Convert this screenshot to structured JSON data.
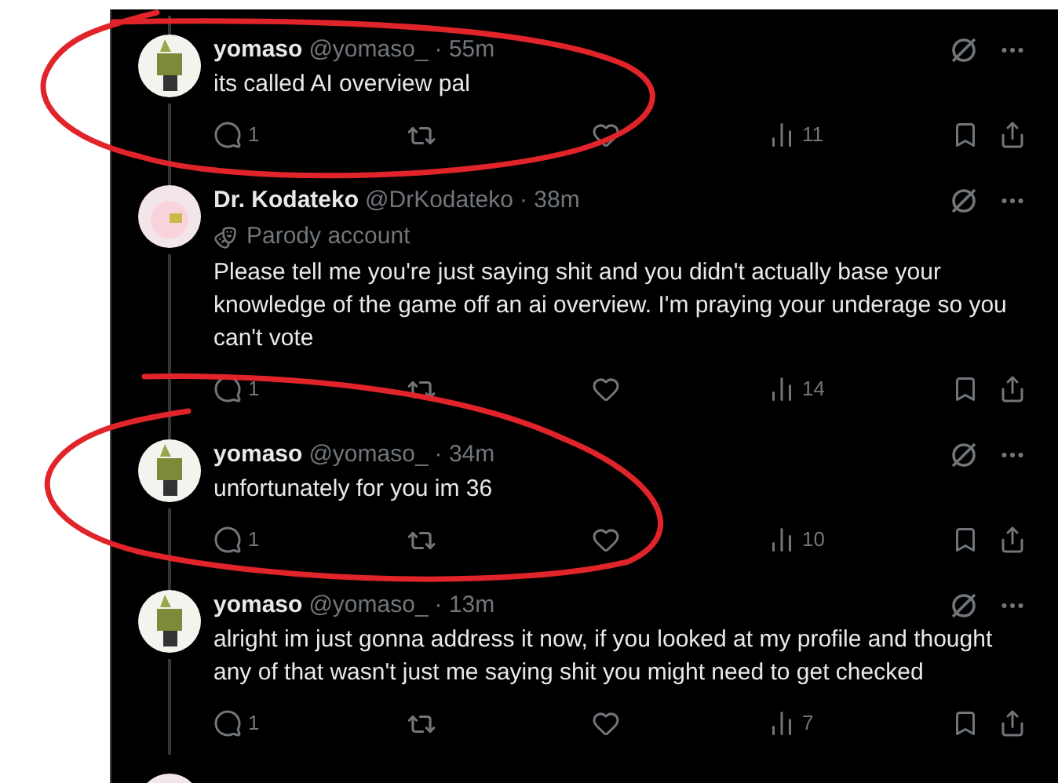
{
  "replies": [
    {
      "name": "yomaso",
      "handle": "@yomaso_",
      "time": "· 55m",
      "kind": "figure",
      "text": [
        "its called AI overview pal"
      ],
      "reply_count": "1",
      "views": "11"
    },
    {
      "name": "Dr. Kodateko",
      "handle": "@DrKodateko",
      "time": "· 38m",
      "badge": "Parody account",
      "kind": "pale",
      "text": [
        "Please tell me you're just saying shit and you didn't actually base your",
        "knowledge of the game off an ai overview. I'm praying your underage so you",
        "can't vote"
      ],
      "reply_count": "1",
      "views": "14"
    },
    {
      "name": "yomaso",
      "handle": "@yomaso_",
      "time": "· 34m",
      "kind": "figure",
      "text": [
        "unfortunately for you im 36"
      ],
      "reply_count": "1",
      "views": "10"
    },
    {
      "name": "yomaso",
      "handle": "@yomaso_",
      "time": "· 13m",
      "kind": "figure",
      "text": [
        "alright im just gonna address it now, if you looked at my profile and thought",
        "any of that wasn't just me saying shit you might need to get checked"
      ],
      "reply_count": "1",
      "views": "7"
    }
  ]
}
